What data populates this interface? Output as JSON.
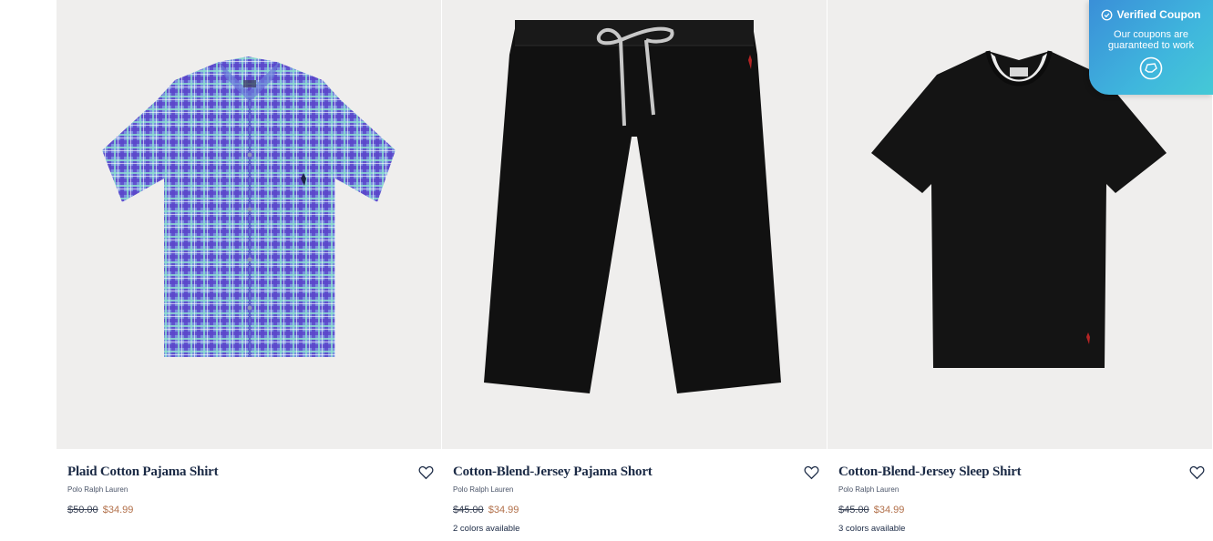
{
  "products": [
    {
      "title": "Plaid Cotton Pajama Shirt",
      "brand": "Polo Ralph Lauren",
      "old_price": "$50.00",
      "sale_price": "$34.99",
      "colors": ""
    },
    {
      "title": "Cotton-Blend-Jersey Pajama Short",
      "brand": "Polo Ralph Lauren",
      "old_price": "$45.00",
      "sale_price": "$34.99",
      "colors": "2 colors available"
    },
    {
      "title": "Cotton-Blend-Jersey Sleep Shirt",
      "brand": "Polo Ralph Lauren",
      "old_price": "$45.00",
      "sale_price": "$34.99",
      "colors": "3 colors available"
    }
  ],
  "coupon": {
    "title": "Verified Coupon",
    "text": "Our coupons are guaranteed to work"
  },
  "colors": {
    "title": "#1b2a45",
    "sale": "#b2704a",
    "image_bg": "#efeeed",
    "coupon_bg": "#3fb6dd"
  },
  "icons": [
    "wishlist-heart-icon",
    "check-circle-icon",
    "coupon-chat-icon"
  ]
}
